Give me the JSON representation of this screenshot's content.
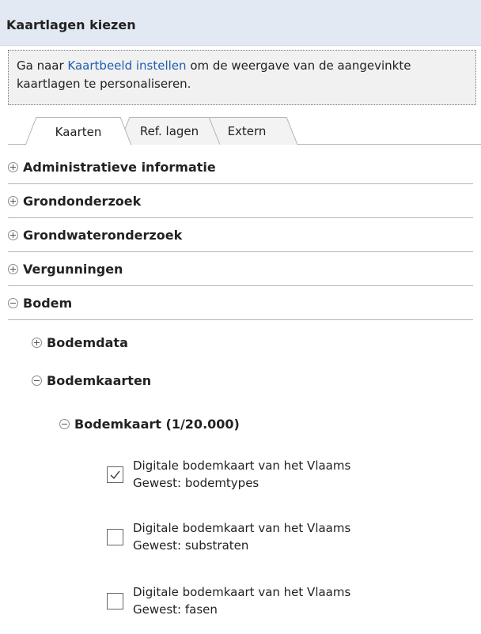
{
  "panel": {
    "title": "Kaartlagen kiezen"
  },
  "info": {
    "prefix": "Ga naar ",
    "link": "Kaartbeeld instellen",
    "suffix": " om de weergave van de aangevinkte kaartlagen te personaliseren."
  },
  "tabs": [
    {
      "label": "Kaarten",
      "active": true
    },
    {
      "label": "Ref. lagen",
      "active": false
    },
    {
      "label": "Extern",
      "active": false
    }
  ],
  "tree": {
    "top_items": [
      {
        "label": "Administratieve informatie",
        "expanded": false
      },
      {
        "label": "Grondonderzoek",
        "expanded": false
      },
      {
        "label": "Grondwateronderzoek",
        "expanded": false
      },
      {
        "label": "Vergunningen",
        "expanded": false
      },
      {
        "label": "Bodem",
        "expanded": true
      }
    ],
    "bodem_children": [
      {
        "label": "Bodemdata",
        "expanded": false
      },
      {
        "label": "Bodemkaarten",
        "expanded": true
      }
    ],
    "bodemkaarten_children": [
      {
        "label": "Bodemkaart (1/20.000)",
        "expanded": true
      }
    ],
    "layers": [
      {
        "line1": "Digitale bodemkaart van het Vlaams",
        "line2": "Gewest: bodemtypes",
        "checked": true
      },
      {
        "line1": "Digitale bodemkaart van het Vlaams",
        "line2": "Gewest: substraten",
        "checked": false
      },
      {
        "line1": "Digitale bodemkaart van het Vlaams",
        "line2": "Gewest: fasen",
        "checked": false
      }
    ]
  },
  "colors": {
    "header_bg": "#e3e9f2",
    "link": "#1d5fb0",
    "info_bg": "#f1f1f1"
  }
}
